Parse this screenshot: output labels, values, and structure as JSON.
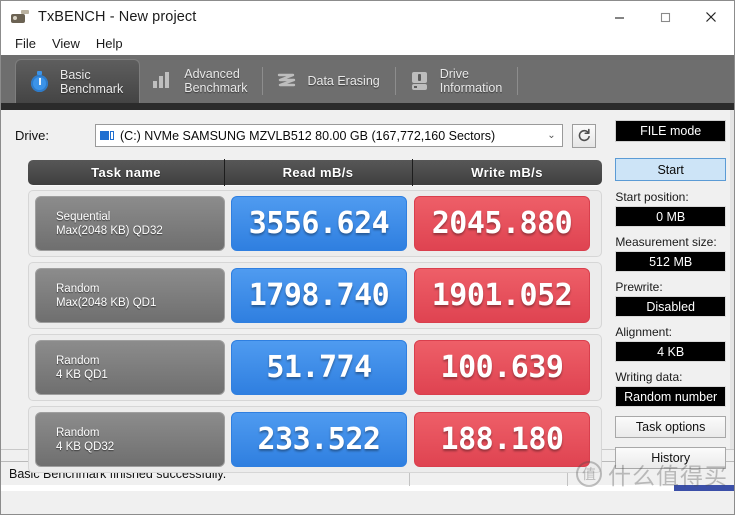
{
  "window": {
    "title": "TxBENCH - New project",
    "icon": "app-icon",
    "minimize": "—",
    "maximize": "☐",
    "close": "✕"
  },
  "menubar": {
    "items": [
      {
        "label": "File"
      },
      {
        "label": "View"
      },
      {
        "label": "Help"
      }
    ]
  },
  "tabs": [
    {
      "line1": "Basic",
      "line2": "Benchmark",
      "icon": "stopwatch-icon",
      "active": true
    },
    {
      "line1": "Advanced",
      "line2": "Benchmark",
      "icon": "bar-chart-icon",
      "active": false
    },
    {
      "line1": "Data Erasing",
      "line2": "",
      "icon": "wave-erase-icon",
      "active": false
    },
    {
      "line1": "Drive",
      "line2": "Information",
      "icon": "drive-icon",
      "active": false
    }
  ],
  "drive": {
    "label": "Drive:",
    "selected": "(C:) NVMe SAMSUNG MZVLB512  80.00 GB (167,772,160 Sectors)",
    "dropdown_arrow": "⌄",
    "refresh_icon": "refresh-icon"
  },
  "table": {
    "headers": {
      "task": "Task name",
      "read": "Read mB/s",
      "write": "Write mB/s"
    },
    "rows": [
      {
        "task_line1": "Sequential",
        "task_line2": "Max(2048 KB) QD32",
        "read": "3556.624",
        "write": "2045.880"
      },
      {
        "task_line1": "Random",
        "task_line2": "Max(2048 KB) QD1",
        "read": "1798.740",
        "write": "1901.052"
      },
      {
        "task_line1": "Random",
        "task_line2": "4 KB QD1",
        "read": "51.774",
        "write": "100.639"
      },
      {
        "task_line1": "Random",
        "task_line2": "4 KB QD32",
        "read": "233.522",
        "write": "188.180"
      }
    ]
  },
  "sidebar": {
    "mode_badge": "FILE mode",
    "start_button": "Start",
    "fields": [
      {
        "label": "Start position:",
        "value": "0 MB"
      },
      {
        "label": "Measurement size:",
        "value": "512 MB"
      },
      {
        "label": "Prewrite:",
        "value": "Disabled"
      },
      {
        "label": "Alignment:",
        "value": "4 KB"
      },
      {
        "label": "Writing data:",
        "value": "Random number"
      }
    ],
    "buttons": [
      {
        "label": "Task options"
      },
      {
        "label": "History"
      }
    ]
  },
  "statusbar": {
    "message": "Basic Benchmark finished successfully."
  },
  "watermark": {
    "logo": "值",
    "text": "什么值得买"
  },
  "colors": {
    "read_blue": "#3b86ea",
    "write_red": "#e4525e",
    "tab_bar": "#6e6e6e",
    "accent_start": "#cde4f7"
  }
}
